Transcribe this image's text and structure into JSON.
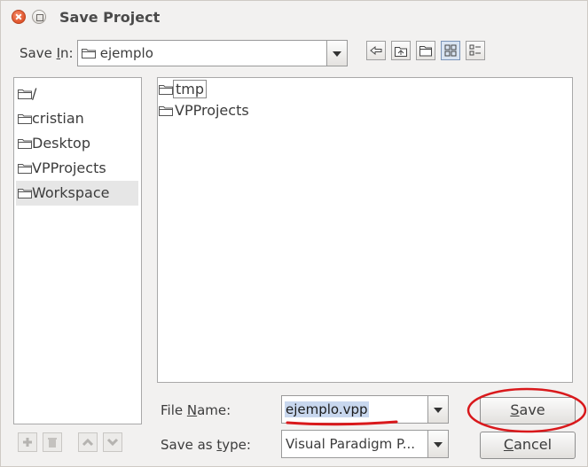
{
  "window": {
    "title": "Save Project"
  },
  "save_in": {
    "label_before": "Save ",
    "label_mnemonic": "I",
    "label_after": "n:",
    "value": "ejemplo"
  },
  "toolbar": {
    "buttons": [
      {
        "icon": "up-one-level-icon"
      },
      {
        "icon": "home-icon"
      },
      {
        "icon": "new-folder-icon"
      },
      {
        "icon": "list-view-icon",
        "active": true
      },
      {
        "icon": "details-view-icon"
      }
    ]
  },
  "shortcuts": [
    {
      "label": "/"
    },
    {
      "label": "cristian"
    },
    {
      "label": "Desktop"
    },
    {
      "label": "VPProjects"
    },
    {
      "label": "Workspace",
      "selected": true
    }
  ],
  "files": [
    {
      "name": "tmp",
      "focused": true
    },
    {
      "name": "VPProjects"
    }
  ],
  "file_name": {
    "label_before": "File ",
    "label_mnemonic": "N",
    "label_after": "ame:",
    "value": "ejemplo.vpp"
  },
  "save_as_type": {
    "label_before": "Save as ",
    "label_mnemonic": "t",
    "label_after": "ype:",
    "value": "Visual Paradigm P..."
  },
  "buttons": {
    "save_mnemonic": "S",
    "save_rest": "ave",
    "cancel_mnemonic": "C",
    "cancel_rest": "ancel"
  },
  "annotations": {
    "highlight_color": "#d9191c"
  }
}
